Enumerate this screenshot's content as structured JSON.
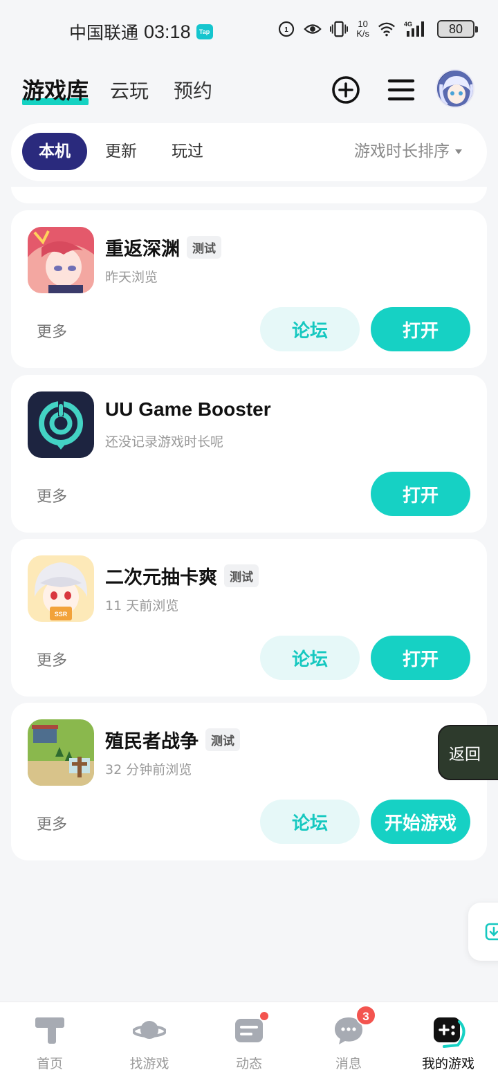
{
  "status_bar": {
    "carrier": "中国联通",
    "time": "03:18",
    "app_badge": "Tap",
    "speed_value": "10",
    "speed_unit": "K/s",
    "network": "4G",
    "battery": "80"
  },
  "header": {
    "tabs": [
      {
        "label": "游戏库",
        "active": true
      },
      {
        "label": "云玩",
        "active": false
      },
      {
        "label": "预约",
        "active": false
      }
    ],
    "icons": [
      "add-circle-icon",
      "menu-icon"
    ],
    "accent_color": "#15d2c2"
  },
  "filter": {
    "chips": [
      {
        "label": "本机",
        "active": true
      },
      {
        "label": "更新",
        "active": false
      },
      {
        "label": "玩过",
        "active": false
      }
    ],
    "sort_label": "游戏时长排序"
  },
  "games": [
    {
      "title": "重返深渊",
      "tag": "测试",
      "subtitle": "昨天浏览",
      "more": "更多",
      "forum": "论坛",
      "action": "打开"
    },
    {
      "title": "UU Game Booster",
      "tag": "",
      "subtitle": "还没记录游戏时长呢",
      "more": "更多",
      "forum": "",
      "action": "打开"
    },
    {
      "title": "二次元抽卡爽",
      "tag": "测试",
      "subtitle": "11 天前浏览",
      "more": "更多",
      "forum": "论坛",
      "action": "打开"
    },
    {
      "title": "殖民者战争",
      "tag": "测试",
      "subtitle": "32 分钟前浏览",
      "more": "更多",
      "forum": "论坛",
      "action": "开始游戏"
    }
  ],
  "floating": {
    "back_label": "返回"
  },
  "bottom_nav": {
    "items": [
      {
        "label": "首页",
        "icon": "home-t-icon"
      },
      {
        "label": "找游戏",
        "icon": "planet-icon"
      },
      {
        "label": "动态",
        "icon": "feed-icon"
      },
      {
        "label": "消息",
        "icon": "chat-icon",
        "badge": "3"
      },
      {
        "label": "我的游戏",
        "icon": "gamepad-icon",
        "active": true
      }
    ]
  },
  "colors": {
    "primary": "#16d1c4",
    "primary_light": "#e6f8f8",
    "active_chip": "#2a2a7d",
    "badge": "#f3544f"
  }
}
